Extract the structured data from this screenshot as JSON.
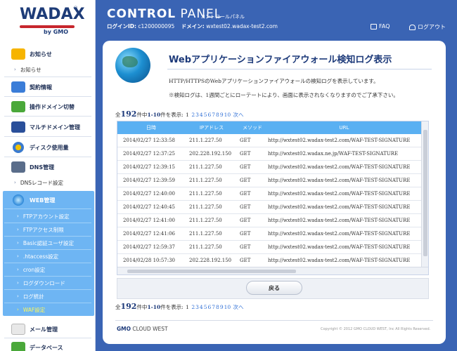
{
  "logo": {
    "brand": "WADAX",
    "reg": "®",
    "by": "by GMO"
  },
  "header": {
    "title_bold": "CONTROL",
    "title_rest": " PANEL",
    "subtitle": "コントロールパネル",
    "login_label": "ログインID:",
    "login_id": "c1200000095",
    "domain_label": "ドメイン:",
    "domain": "wxtest02.wadax-test2.com",
    "faq": "FAQ",
    "logout": "ログアウト"
  },
  "sidebar": {
    "oshirase_cat": "お知らせ",
    "oshirase_sub": "お知らせ",
    "keiyaku": "契約情報",
    "sousa_domain": "操作ドメイン切替",
    "multi_domain": "マルチドメイン管理",
    "disk": "ディスク使用量",
    "dns": "DNS管理",
    "dns_record": "DNSレコード設定",
    "web": "WEB管理",
    "web_items": [
      "FTPアカウント設定",
      "FTPアクセス制限",
      "Basic認証ユーザ設定",
      ".htaccess設定",
      "cron設定",
      "ログダウンロード",
      "ログ統計",
      "WAF設定"
    ],
    "mail": "メール管理",
    "database": "データベース"
  },
  "main": {
    "title": "Webアプリケーションファイアウォール検知ログ表示",
    "desc1": "HTTP/HTTPSのWebアプリケーションファイアウォールの検知ログを表示しています。",
    "desc2": "※検知ログは、1週間ごとにローテートにより、画面に表示されなくなりますのでご了承下さい。",
    "pager": {
      "prefix": "全",
      "total": "192",
      "mid": "件中",
      "range": "1-10",
      "suffix": "件を表示:",
      "current": "1",
      "pages": [
        "2",
        "3",
        "4",
        "5",
        "6",
        "7",
        "8",
        "9",
        "10"
      ],
      "next": "次へ"
    },
    "columns": [
      "日時",
      "IPアドレス",
      "メソッド",
      "URL"
    ],
    "rows": [
      [
        "2014/02/27 12:33:58",
        "211.1.227.50",
        "GET",
        "http://wxtest02.wadax-test2.com/WAF-TEST-SIGNATURE"
      ],
      [
        "2014/02/27 12:37:25",
        "202.228.192.150",
        "GET",
        "http://wxtest02.wadax.ne.jp/WAF-TEST-SIGNATURE"
      ],
      [
        "2014/02/27 12:39:15",
        "211.1.227.50",
        "GET",
        "http://wxtest02.wadax-test2.com/WAF-TEST-SIGNATURE"
      ],
      [
        "2014/02/27 12:39:59",
        "211.1.227.50",
        "GET",
        "http://wxtest02.wadax-test2.com/WAF-TEST-SIGNATURE"
      ],
      [
        "2014/02/27 12:40:00",
        "211.1.227.50",
        "GET",
        "http://wxtest02.wadax-test2.com/WAF-TEST-SIGNATURE"
      ],
      [
        "2014/02/27 12:40:45",
        "211.1.227.50",
        "GET",
        "http://wxtest02.wadax-test2.com/WAF-TEST-SIGNATURE"
      ],
      [
        "2014/02/27 12:41:00",
        "211.1.227.50",
        "GET",
        "http://wxtest02.wadax-test2.com/WAF-TEST-SIGNATURE"
      ],
      [
        "2014/02/27 12:41:06",
        "211.1.227.50",
        "GET",
        "http://wxtest02.wadax-test2.com/WAF-TEST-SIGNATURE"
      ],
      [
        "2014/02/27 12:59:37",
        "211.1.227.50",
        "GET",
        "http://wxtest02.wadax-test2.com/WAF-TEST-SIGNATURE"
      ],
      [
        "2014/02/28 10:57:30",
        "202.228.192.150",
        "GET",
        "http://wxtest02.wadax-test2.com/WAF-TEST-SIGNATURE"
      ]
    ],
    "back": "戻る"
  },
  "footer": {
    "logo_bold": "GMO",
    "logo_rest": " CLOUD WEST",
    "copyright": "Copyright © 2012 GMO CLOUD WEST, Inc All Rights Reserved."
  },
  "colors": {
    "background": "#3a64b4",
    "accent": "#5ab0f2",
    "active_group": "#6eb5f3",
    "active_item": "#fff85a"
  }
}
